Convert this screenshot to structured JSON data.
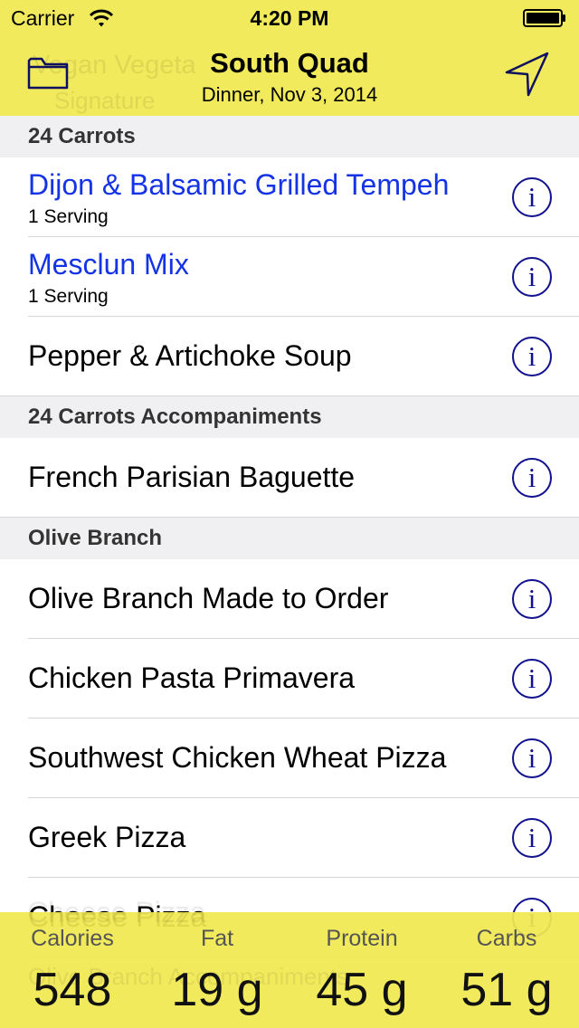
{
  "status_bar": {
    "carrier": "Carrier",
    "time": "4:20 PM"
  },
  "nav": {
    "title": "South Quad",
    "subtitle": "Dinner, Nov 3, 2014"
  },
  "ghost": {
    "header_line1": "Vegan Vegeta",
    "header_line2": "Signature",
    "footer_line": "Olive Branch Accompaniments",
    "footer_line2": "Cheese Pizza"
  },
  "sections": [
    {
      "name": "24 Carrots",
      "items": [
        {
          "title": "Dijon & Balsamic Grilled Tempeh",
          "serving": "1 Serving"
        },
        {
          "title": "Mesclun Mix",
          "serving": "1 Serving"
        },
        {
          "title": "Pepper & Artichoke Soup"
        }
      ]
    },
    {
      "name": "24 Carrots Accompaniments",
      "items": [
        {
          "title": "French Parisian Baguette"
        }
      ]
    },
    {
      "name": "Olive Branch",
      "items": [
        {
          "title": "Olive Branch Made to Order"
        },
        {
          "title": "Chicken Pasta Primavera"
        },
        {
          "title": "Southwest Chicken Wheat Pizza"
        },
        {
          "title": "Greek Pizza"
        },
        {
          "title": "Cheese Pizza"
        }
      ]
    }
  ],
  "info_glyph": "i",
  "footer": {
    "stats": [
      {
        "label": "Calories",
        "value": "548"
      },
      {
        "label": "Fat",
        "value": "19 g"
      },
      {
        "label": "Protein",
        "value": "45 g"
      },
      {
        "label": "Carbs",
        "value": "51 g"
      }
    ]
  },
  "colors": {
    "bar_yellow": "#f0e850",
    "selected_item_blue": "#1433e6",
    "info_icon_navy": "#101090",
    "section_header_bg": "#f0f0f2"
  }
}
